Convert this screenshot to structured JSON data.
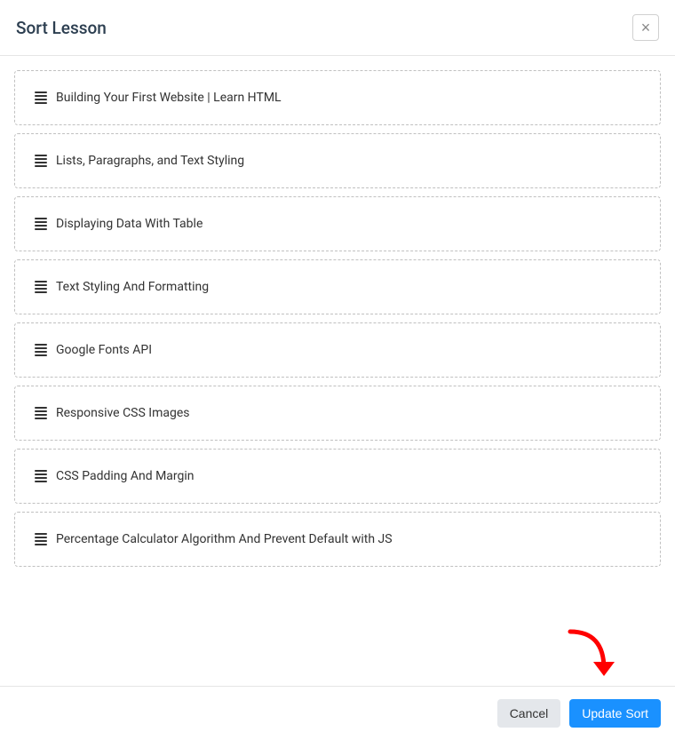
{
  "header": {
    "title": "Sort Lesson"
  },
  "lessons": [
    {
      "label": "Building Your First Website | Learn HTML"
    },
    {
      "label": "Lists, Paragraphs, and Text Styling"
    },
    {
      "label": "Displaying Data With Table"
    },
    {
      "label": "Text Styling And Formatting"
    },
    {
      "label": "Google Fonts API"
    },
    {
      "label": "Responsive CSS Images"
    },
    {
      "label": "CSS Padding And Margin"
    },
    {
      "label": "Percentage Calculator Algorithm And Prevent Default with JS"
    }
  ],
  "footer": {
    "cancel_label": "Cancel",
    "submit_label": "Update Sort"
  },
  "annotation": {
    "arrow_color": "#ff0000"
  }
}
